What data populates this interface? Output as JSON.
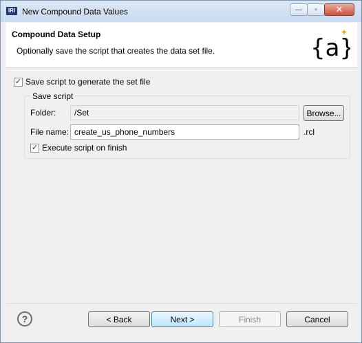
{
  "window": {
    "title": "New Compound Data Values",
    "app_icon_text": "IRI",
    "minimize_symbol": "—",
    "maximize_symbol": "▫",
    "close_symbol": "✕"
  },
  "header": {
    "title": "Compound Data Setup",
    "description": "Optionally save the script that creates the data set file.",
    "logo_text": "{a}",
    "logo_sparkle": "✦"
  },
  "save_script_checkbox": {
    "label": "Save script to generate the set file",
    "checked": true,
    "mark": "✓"
  },
  "group": {
    "title": "Save script",
    "folder_label": "Folder:",
    "folder_value": "/Set",
    "browse_label": "Browse...",
    "file_name_label": "File name:",
    "file_name_value": "create_us_phone_numbers",
    "file_extension": ".rcl",
    "execute_checkbox": {
      "label": "Execute script on finish",
      "checked": true,
      "mark": "✓"
    }
  },
  "footer": {
    "help_symbol": "?",
    "back_label": "< Back",
    "next_label": "Next >",
    "finish_label": "Finish",
    "cancel_label": "Cancel"
  },
  "colors": {
    "window_bg": "#f0f0f0",
    "header_bg": "#ffffff",
    "logo_accent": "#f0a800",
    "checkbox_mark": "#1f3e7a"
  }
}
